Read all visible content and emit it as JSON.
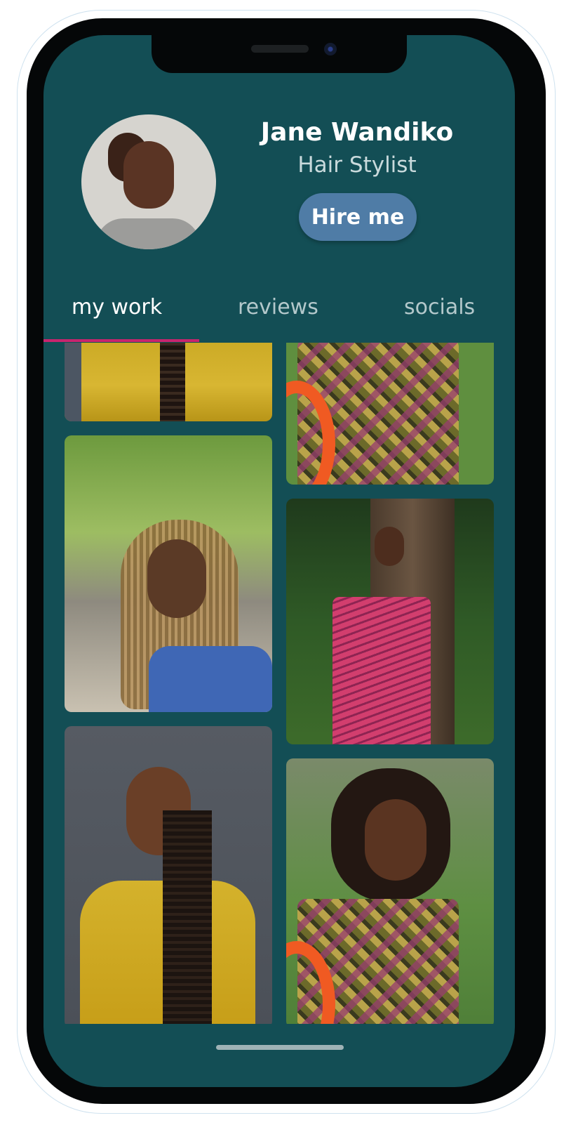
{
  "profile": {
    "name": "Jane Wandiko",
    "role": "Hair Stylist",
    "hire_label": "Hire me"
  },
  "tabs": [
    {
      "label": "my work",
      "active": true
    },
    {
      "label": "reviews",
      "active": false
    },
    {
      "label": "socials",
      "active": false
    }
  ],
  "gallery": {
    "photos": [
      "photo-braids-yellow-blouse-top",
      "photo-african-print-dress-top",
      "photo-blonde-braids-blue-top",
      "photo-pink-striped-dress-tree",
      "photo-braids-yellow-blouse",
      "photo-african-print-dress-curls"
    ]
  },
  "colors": {
    "screen_background": "#134e55",
    "hire_button": "#4f7ca6",
    "tab_active_indicator": "#c8246e",
    "tab_inactive_text": "#b3c8cb"
  }
}
